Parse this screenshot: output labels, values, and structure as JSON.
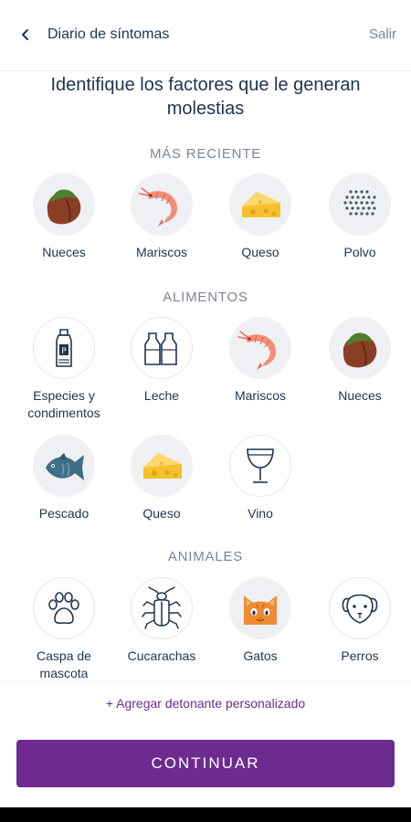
{
  "header": {
    "title": "Diario de síntomas",
    "exit_label": "Salir"
  },
  "page_title": "Identifique los factores que le generan molestias",
  "sections": {
    "recent": {
      "title": "MÁS RECIENTE",
      "items": [
        {
          "label": "Nueces",
          "icon": "nut-icon"
        },
        {
          "label": "Mariscos",
          "icon": "shrimp-icon"
        },
        {
          "label": "Queso",
          "icon": "cheese-icon"
        },
        {
          "label": "Polvo",
          "icon": "dust-icon"
        }
      ]
    },
    "food": {
      "title": "ALIMENTOS",
      "items": [
        {
          "label": "Especies y\ncondimentos",
          "icon": "pepper-shaker-icon"
        },
        {
          "label": "Leche",
          "icon": "milk-bottles-icon"
        },
        {
          "label": "Mariscos",
          "icon": "shrimp-icon"
        },
        {
          "label": "Nueces",
          "icon": "nut-icon"
        },
        {
          "label": "Pescado",
          "icon": "fish-icon"
        },
        {
          "label": "Queso",
          "icon": "cheese-icon"
        },
        {
          "label": "Vino",
          "icon": "wine-glass-icon"
        }
      ]
    },
    "animals": {
      "title": "ANIMALES",
      "items": [
        {
          "label": "Caspa de\nmascota",
          "icon": "paw-icon"
        },
        {
          "label": "Cucarachas",
          "icon": "cockroach-icon"
        },
        {
          "label": "Gatos",
          "icon": "cat-icon"
        },
        {
          "label": "Perros",
          "icon": "dog-icon"
        }
      ]
    }
  },
  "add_trigger_label": "+ Agregar detonante personalizado",
  "continue_label": "CONTINUAR",
  "colors": {
    "primary": "#6d2a91",
    "text": "#1f3450",
    "muted": "#7b8794"
  }
}
